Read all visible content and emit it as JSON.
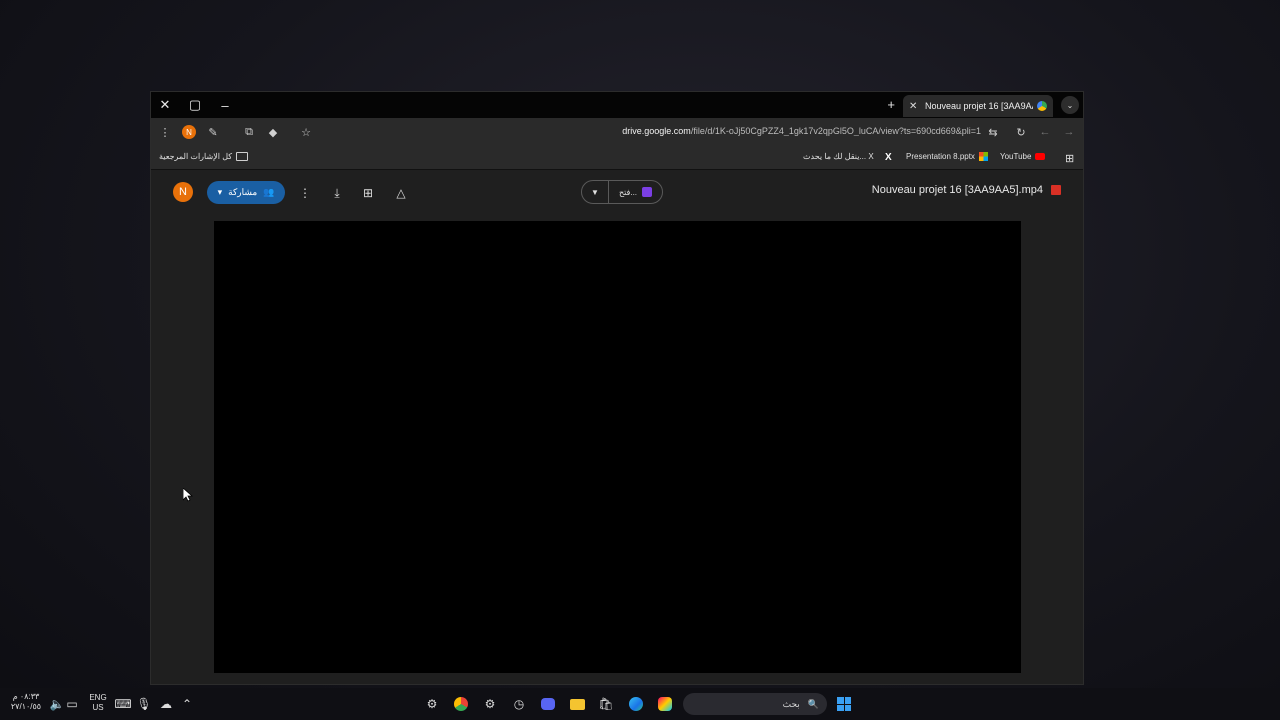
{
  "browser": {
    "tab_title": "Nouveau projet 16 [3AA9AA5]...",
    "url_host": "drive.google.com",
    "url_path": "/file/d/1K-oJj50CgPZZ4_1gk17v2qpGl5O_luCA/view?ts=690cd669&pli=1",
    "bookmarks": {
      "all_bookmarks": "كل الإشارات المرجعية",
      "item_ar": "ينقل لك ما يحدث... X",
      "presentation": "Presentation 8.pptx",
      "youtube": "YouTube"
    }
  },
  "drive": {
    "avatar_letter": "N",
    "share_label": "مشاركة",
    "open_with_label": "فتح...",
    "file_title": "Nouveau projet 16 [3AA9AA5].mp4"
  },
  "taskbar": {
    "search_placeholder": "بحث",
    "lang_top": "ENG",
    "lang_bottom": "US",
    "time": "٠٨:٣٣ م",
    "date": "٢٧/١٠/٥٥"
  },
  "colors": {
    "accent": "#1a5fa3",
    "avatar": "#e8710a",
    "player_bg": "#000000"
  },
  "icons": [
    "close-icon",
    "maximize-icon",
    "minimize-icon",
    "new-tab-icon",
    "chrome-menu-icon",
    "extensions-icon",
    "star-icon",
    "reload-icon",
    "back-icon",
    "forward-icon",
    "download-icon",
    "add-shortcut-icon",
    "drive-add-icon",
    "more-icon"
  ]
}
